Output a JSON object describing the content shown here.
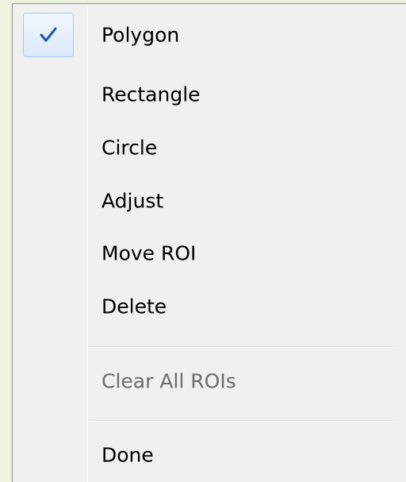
{
  "menu": {
    "items": [
      {
        "label": "Polygon",
        "checked": true
      },
      {
        "label": "Rectangle"
      },
      {
        "label": "Circle"
      },
      {
        "label": "Adjust"
      },
      {
        "label": "Move ROI"
      },
      {
        "label": "Delete"
      },
      {
        "label": "Clear All ROIs",
        "disabled": true
      },
      {
        "label": "Done"
      }
    ]
  },
  "colors": {
    "check": "#1d4fae",
    "disabled_text": "#6d6d6d"
  }
}
